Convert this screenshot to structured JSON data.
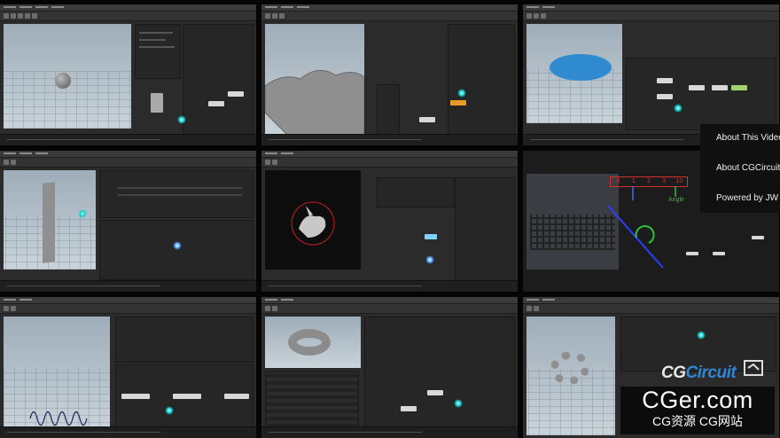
{
  "menu": {
    "items": [
      "About This Video",
      "About CGCircuit",
      "Powered by JW"
    ]
  },
  "diagram": {
    "ruler_values": [
      "0",
      "1",
      "2",
      "3",
      "10"
    ],
    "angle_label": "Angle"
  },
  "brand": {
    "cg": "CG",
    "circuit": "Circuit"
  },
  "watermark": {
    "line1": "CGer.com",
    "line2": "CG资源 CG网站"
  },
  "colors": {
    "accent_blue": "#2f86d6",
    "cyan_marker": "#22cddd",
    "red_box": "#d63030",
    "green_label": "#2fbf3a",
    "pad_blue": "#2f8ad0"
  }
}
